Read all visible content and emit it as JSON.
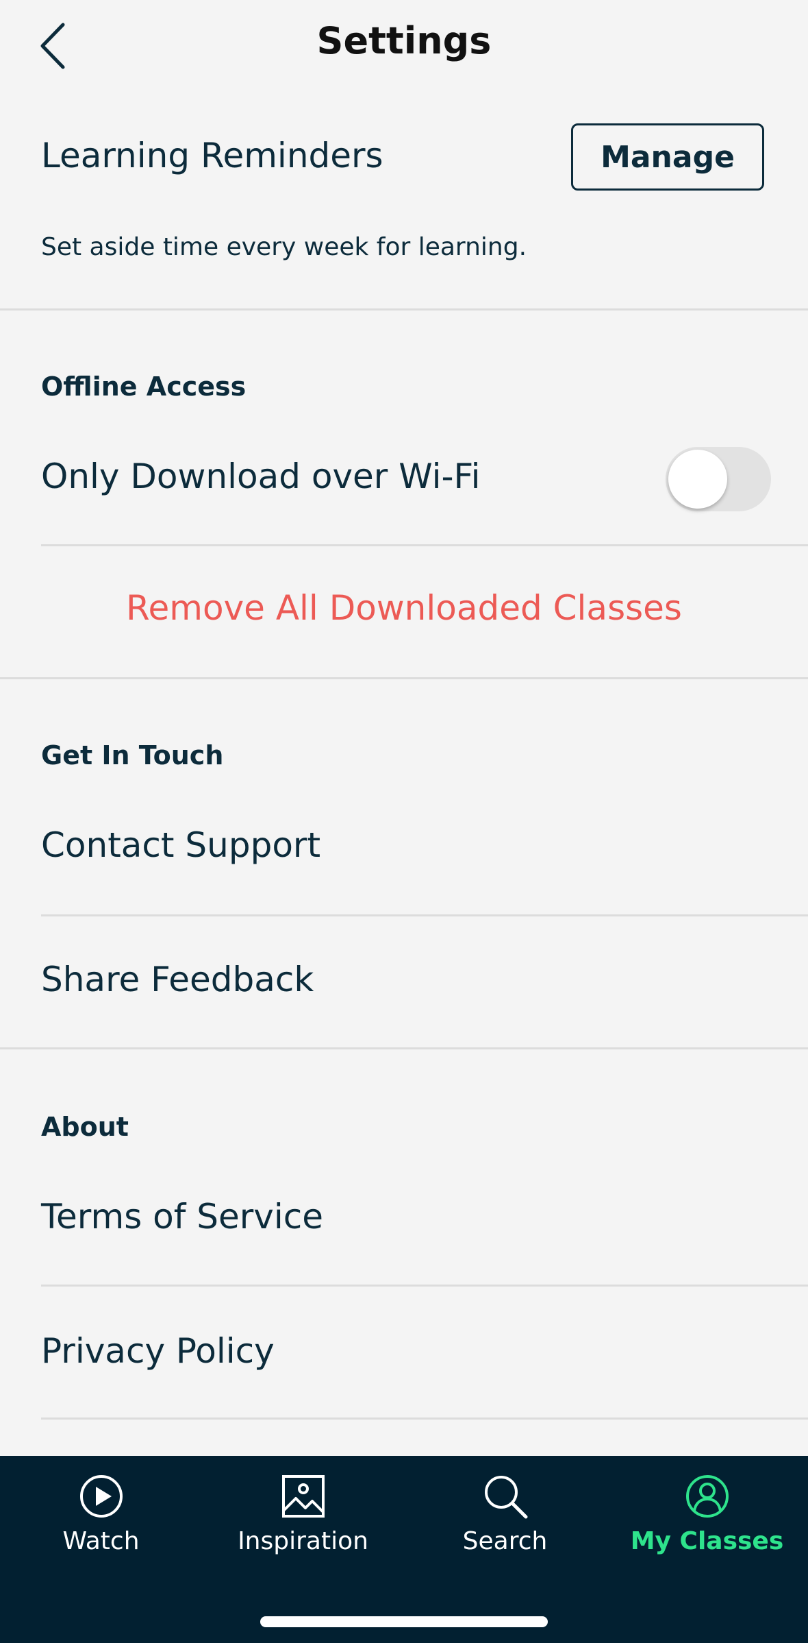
{
  "header": {
    "title": "Settings"
  },
  "reminders": {
    "label": "Learning Reminders",
    "manage_label": "Manage",
    "description": "Set aside time every week for learning."
  },
  "offline": {
    "heading": "Offline Access",
    "wifi_label": "Only Download over Wi-Fi",
    "wifi_enabled": false,
    "remove_label": "Remove All Downloaded Classes"
  },
  "contact": {
    "heading": "Get In Touch",
    "support_label": "Contact Support",
    "feedback_label": "Share Feedback"
  },
  "about": {
    "heading": "About",
    "terms_label": "Terms of Service",
    "privacy_label": "Privacy Policy"
  },
  "tabbar": {
    "tabs": [
      {
        "label": "Watch",
        "icon": "play-circle-icon",
        "active": false
      },
      {
        "label": "Inspiration",
        "icon": "image-icon",
        "active": false
      },
      {
        "label": "Search",
        "icon": "search-icon",
        "active": false
      },
      {
        "label": "My Classes",
        "icon": "user-circle-icon",
        "active": true
      }
    ]
  },
  "colors": {
    "background": "#f4f4f4",
    "text": "#0c2b3b",
    "danger": "#ec5a55",
    "tabbar": "#022031",
    "active_tab": "#2ee38c"
  }
}
